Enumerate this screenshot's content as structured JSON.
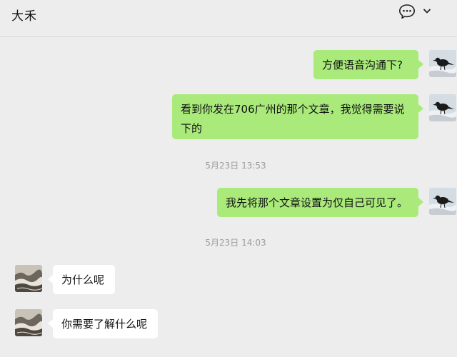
{
  "header": {
    "title": "大禾",
    "chat_icon": "chat-bubble-icon",
    "menu_icon": "chevron-down-icon"
  },
  "colors": {
    "background": "#ededed",
    "outgoing_bubble": "#a9ea7a",
    "incoming_bubble": "#ffffff",
    "timestamp_text": "#9d9d9d"
  },
  "messages": [
    {
      "direction": "outgoing",
      "text": "方便语音沟通下?"
    },
    {
      "direction": "outgoing",
      "text": "看到你发在706广州的那个文章，我觉得需要说下的"
    },
    {
      "type": "timestamp",
      "text": "5月23日 13:53"
    },
    {
      "direction": "outgoing",
      "text": "我先将那个文章设置为仅自己可见了。"
    },
    {
      "type": "timestamp",
      "text": "5月23日 14:03"
    },
    {
      "direction": "incoming",
      "text": "为什么呢"
    },
    {
      "direction": "incoming",
      "text": "你需要了解什么呢"
    }
  ]
}
